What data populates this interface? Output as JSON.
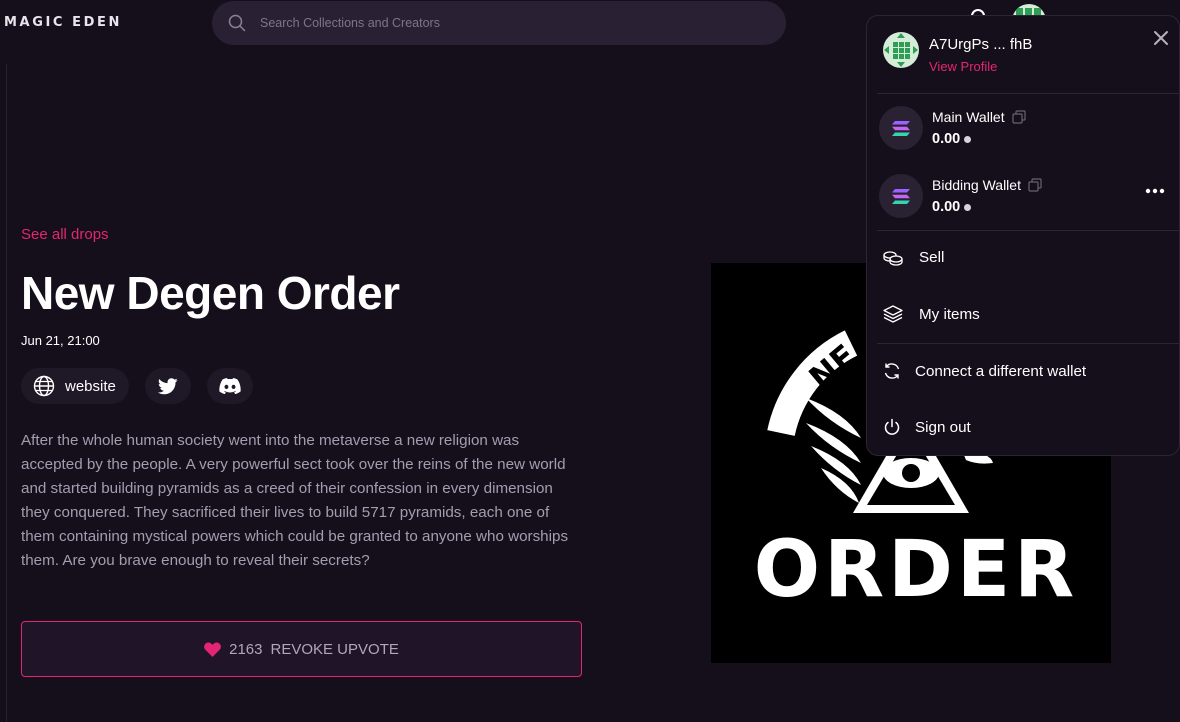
{
  "header": {
    "logo": "MAGIC EDEN",
    "search_placeholder": "Search Collections and Creators"
  },
  "drop": {
    "see_all": "See all drops",
    "title": "New Degen Order",
    "date": "Jun 21, 21:00",
    "website_label": "website",
    "description": "After the whole human society went into the metaverse a new religion was accepted by the people. A very powerful sect took over the reins of the new world and started building pyramids as a creed of their confession in every dimension they conquered. They sacrificed their lives to build 5717 pyramids, each one of them containing mystical powers which could be granted to anyone who worships them. Are you brave enough to reveal their secrets?",
    "upvote_count": "2163",
    "upvote_label": "REVOKE UPVOTE",
    "art_text_top": "NE",
    "art_text_bottom": "ORDER"
  },
  "menu": {
    "profile_name": "A7UrgPs ... fhB",
    "view_profile": "View Profile",
    "wallets": [
      {
        "label": "Main Wallet",
        "balance": "0.00"
      },
      {
        "label": "Bidding Wallet",
        "balance": "0.00"
      }
    ],
    "items": {
      "sell": "Sell",
      "my_items": "My items",
      "connect": "Connect a different wallet",
      "sign_out": "Sign out"
    }
  },
  "colors": {
    "accent": "#e42575",
    "background": "#150f1b",
    "avatar_green": "#2f9e55"
  }
}
